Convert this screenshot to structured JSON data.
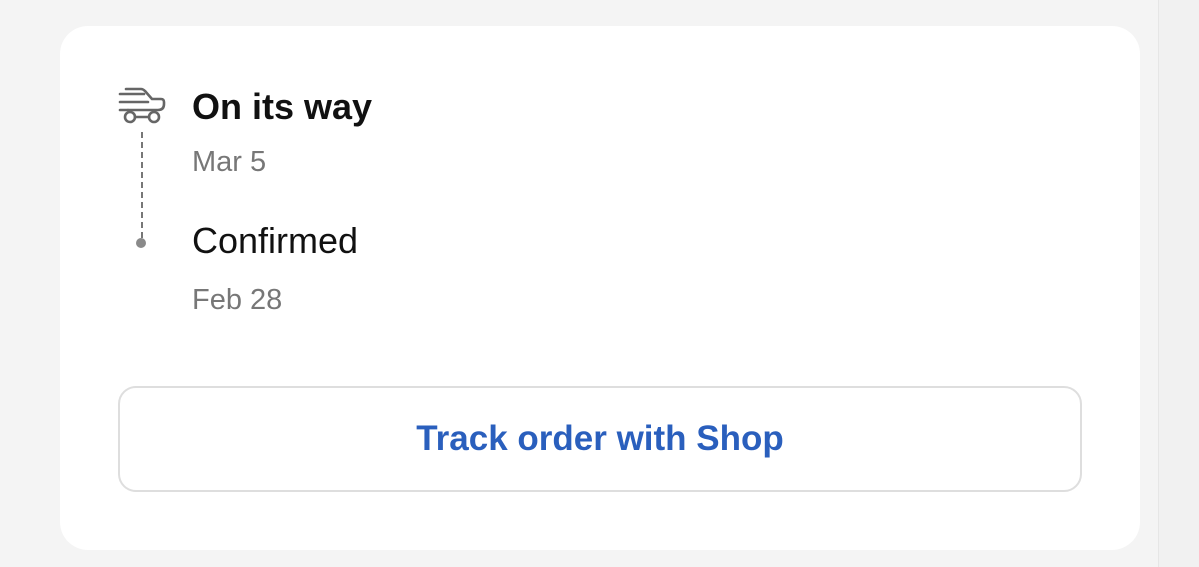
{
  "timeline": {
    "events": [
      {
        "title": "On its way",
        "date": "Mar 5",
        "icon": "delivery-truck-icon"
      },
      {
        "title": "Confirmed",
        "date": "Feb 28",
        "icon": "status-dot-icon"
      }
    ]
  },
  "actions": {
    "track_button_label": "Track order with Shop"
  },
  "colors": {
    "background": "#f4f4f4",
    "card": "#ffffff",
    "text_primary": "#111111",
    "text_secondary": "#777777",
    "link_blue": "#2a5fbd",
    "border": "#dedede"
  }
}
